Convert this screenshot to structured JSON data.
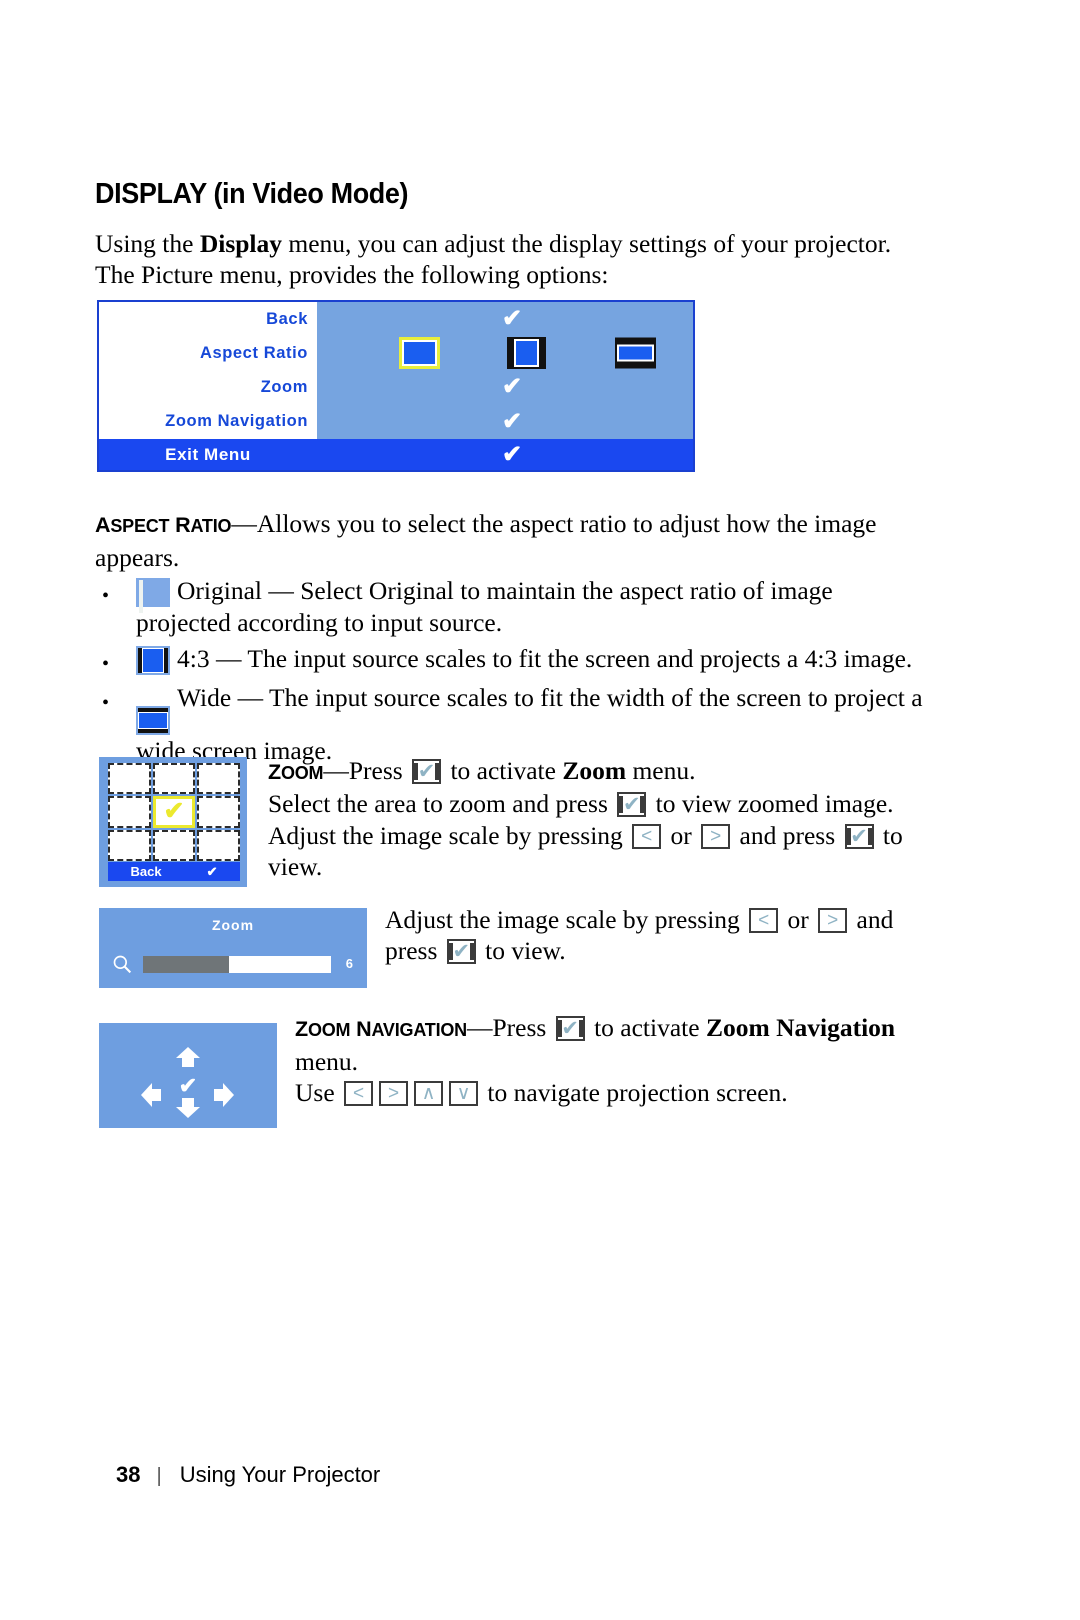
{
  "heading": "DISPLAY (in Video Mode)",
  "intro": {
    "p1": "Using the ",
    "b1": "Display",
    "p2": " menu, you can adjust the display settings of your projector. The Picture menu, provides the following options:"
  },
  "osd": {
    "rows": [
      {
        "label": "Back",
        "value_icon": "check-icon"
      },
      {
        "label": "Aspect Ratio",
        "value_icon": "aspect-ratio-icons"
      },
      {
        "label": "Zoom",
        "value_icon": "check-icon"
      },
      {
        "label": "Zoom Navigation",
        "value_icon": "check-icon"
      }
    ],
    "exit_label": "Exit Menu",
    "exit_icon": "check-icon",
    "aspect_icons": [
      "original-icon",
      "four-three-icon",
      "wide-icon"
    ],
    "selected_aspect": "original-icon",
    "colors": {
      "panel_bg": "#76a4e0",
      "panel_border": "#1a40d0",
      "label_bg": "#ffffff",
      "label_text": "#1648d8",
      "exit_bg": "#1a48f0",
      "highlight": "#e8ee3c"
    }
  },
  "aspect_ratio_section": {
    "term": "Aspect Ratio",
    "term_dash": "—",
    "desc": "Allows you to select the aspect ratio to adjust how the image appears.",
    "bullets": [
      {
        "icon": "original-icon",
        "text": "Original — Select Original to maintain the aspect ratio of image projected according to input source."
      },
      {
        "icon": "four-three-icon",
        "text": "4:3 — The input source scales to fit the screen and projects a 4:3 image."
      },
      {
        "icon": "wide-icon",
        "text": "Wide — The input source scales to fit the width of the screen to project a wide screen image."
      }
    ]
  },
  "zoom_section": {
    "term": "Zoom",
    "term_dash": "—",
    "line1_a": "Press ",
    "line1_key": "enter-key-icon",
    "line1_b": " to activate ",
    "line1_bold": "Zoom",
    "line1_c": " menu.",
    "line2_a": "Select the area to zoom and press ",
    "line2_key": "enter-key-icon",
    "line2_b": " to view zoomed image.",
    "line3_a": "Adjust the image scale by pressing ",
    "line3_key1": "left-arrow-key-icon",
    "line3_b": " or ",
    "line3_key2": "right-arrow-key-icon",
    "line3_c": " and press ",
    "line3_key3": "enter-key-icon",
    "line3_d": " to view.",
    "grid": {
      "rows": 3,
      "cols": 3,
      "selected_cell": 4,
      "back_label": "Back",
      "back_icon": "check-icon"
    }
  },
  "zoom_slider_section": {
    "panel_title": "Zoom",
    "magnifier_icon": "magnifier-icon",
    "value": "6",
    "fill_percent": 46,
    "text_a": "Adjust the image scale by pressing ",
    "key1": "left-arrow-key-icon",
    "text_b": " or ",
    "key2": "right-arrow-key-icon",
    "text_c": " and press ",
    "key3": "enter-key-icon",
    "text_d": " to view."
  },
  "zoom_navigation_section": {
    "term": "Zoom Navigation",
    "term_dash": "—",
    "line1_a": "Press ",
    "line1_key": "enter-key-icon",
    "line1_b": " to activate ",
    "line1_bold": "Zoom Navigation",
    "line1_c": " menu.",
    "line2_a": "Use ",
    "line2_keys": [
      "left-arrow-key-icon",
      "right-arrow-key-icon",
      "up-arrow-key-icon",
      "down-arrow-key-icon"
    ],
    "line2_b": " to navigate projection screen.",
    "pad": {
      "up_icon": "up-arrow-icon",
      "down_icon": "down-arrow-icon",
      "left_icon": "left-arrow-icon",
      "right_icon": "right-arrow-icon",
      "center_icon": "check-icon"
    }
  },
  "footer": {
    "page_number": "38",
    "separator": "|",
    "label": "Using Your Projector"
  },
  "glyphs": {
    "check": "✔",
    "left": "<",
    "right": ">",
    "up": "∧",
    "down": "∨",
    "bullet": "•"
  }
}
